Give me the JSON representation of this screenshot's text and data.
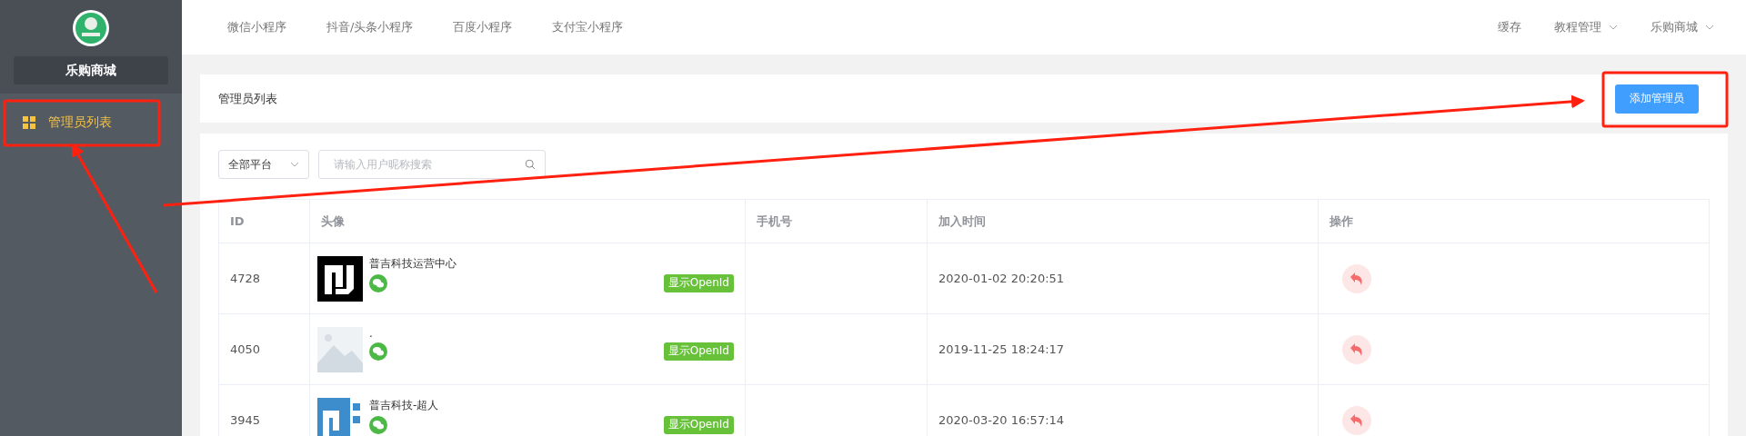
{
  "sidebar": {
    "store_name": "乐购商城",
    "items": [
      {
        "label": "管理员列表",
        "selected": true
      }
    ]
  },
  "top_nav": {
    "tabs": [
      "微信小程序",
      "抖音/头条小程序",
      "百度小程序",
      "支付宝小程序"
    ],
    "right": [
      {
        "label": "缓存",
        "dropdown": false
      },
      {
        "label": "教程管理",
        "dropdown": true
      },
      {
        "label": "乐购商城",
        "dropdown": true
      }
    ]
  },
  "page": {
    "title": "管理员列表",
    "add_button": "添加管理员"
  },
  "filters": {
    "platform": "全部平台",
    "search_placeholder": "请输入用户昵称搜索"
  },
  "table": {
    "columns": [
      "ID",
      "头像",
      "手机号",
      "加入时间",
      "操作"
    ],
    "rows": [
      {
        "id": "4728",
        "nickname": "普吉科技运营中心",
        "joined": "2020-01-02 20:20:51",
        "openid_button": "显示OpenId"
      },
      {
        "id": "4050",
        "nickname": ".",
        "joined": "2019-11-25 18:24:17",
        "openid_button": "显示OpenId"
      },
      {
        "id": "3945",
        "nickname": "普吉科技-超人",
        "joined": "2020-03-20 16:57:14",
        "openid_button": "显示OpenId"
      }
    ]
  }
}
